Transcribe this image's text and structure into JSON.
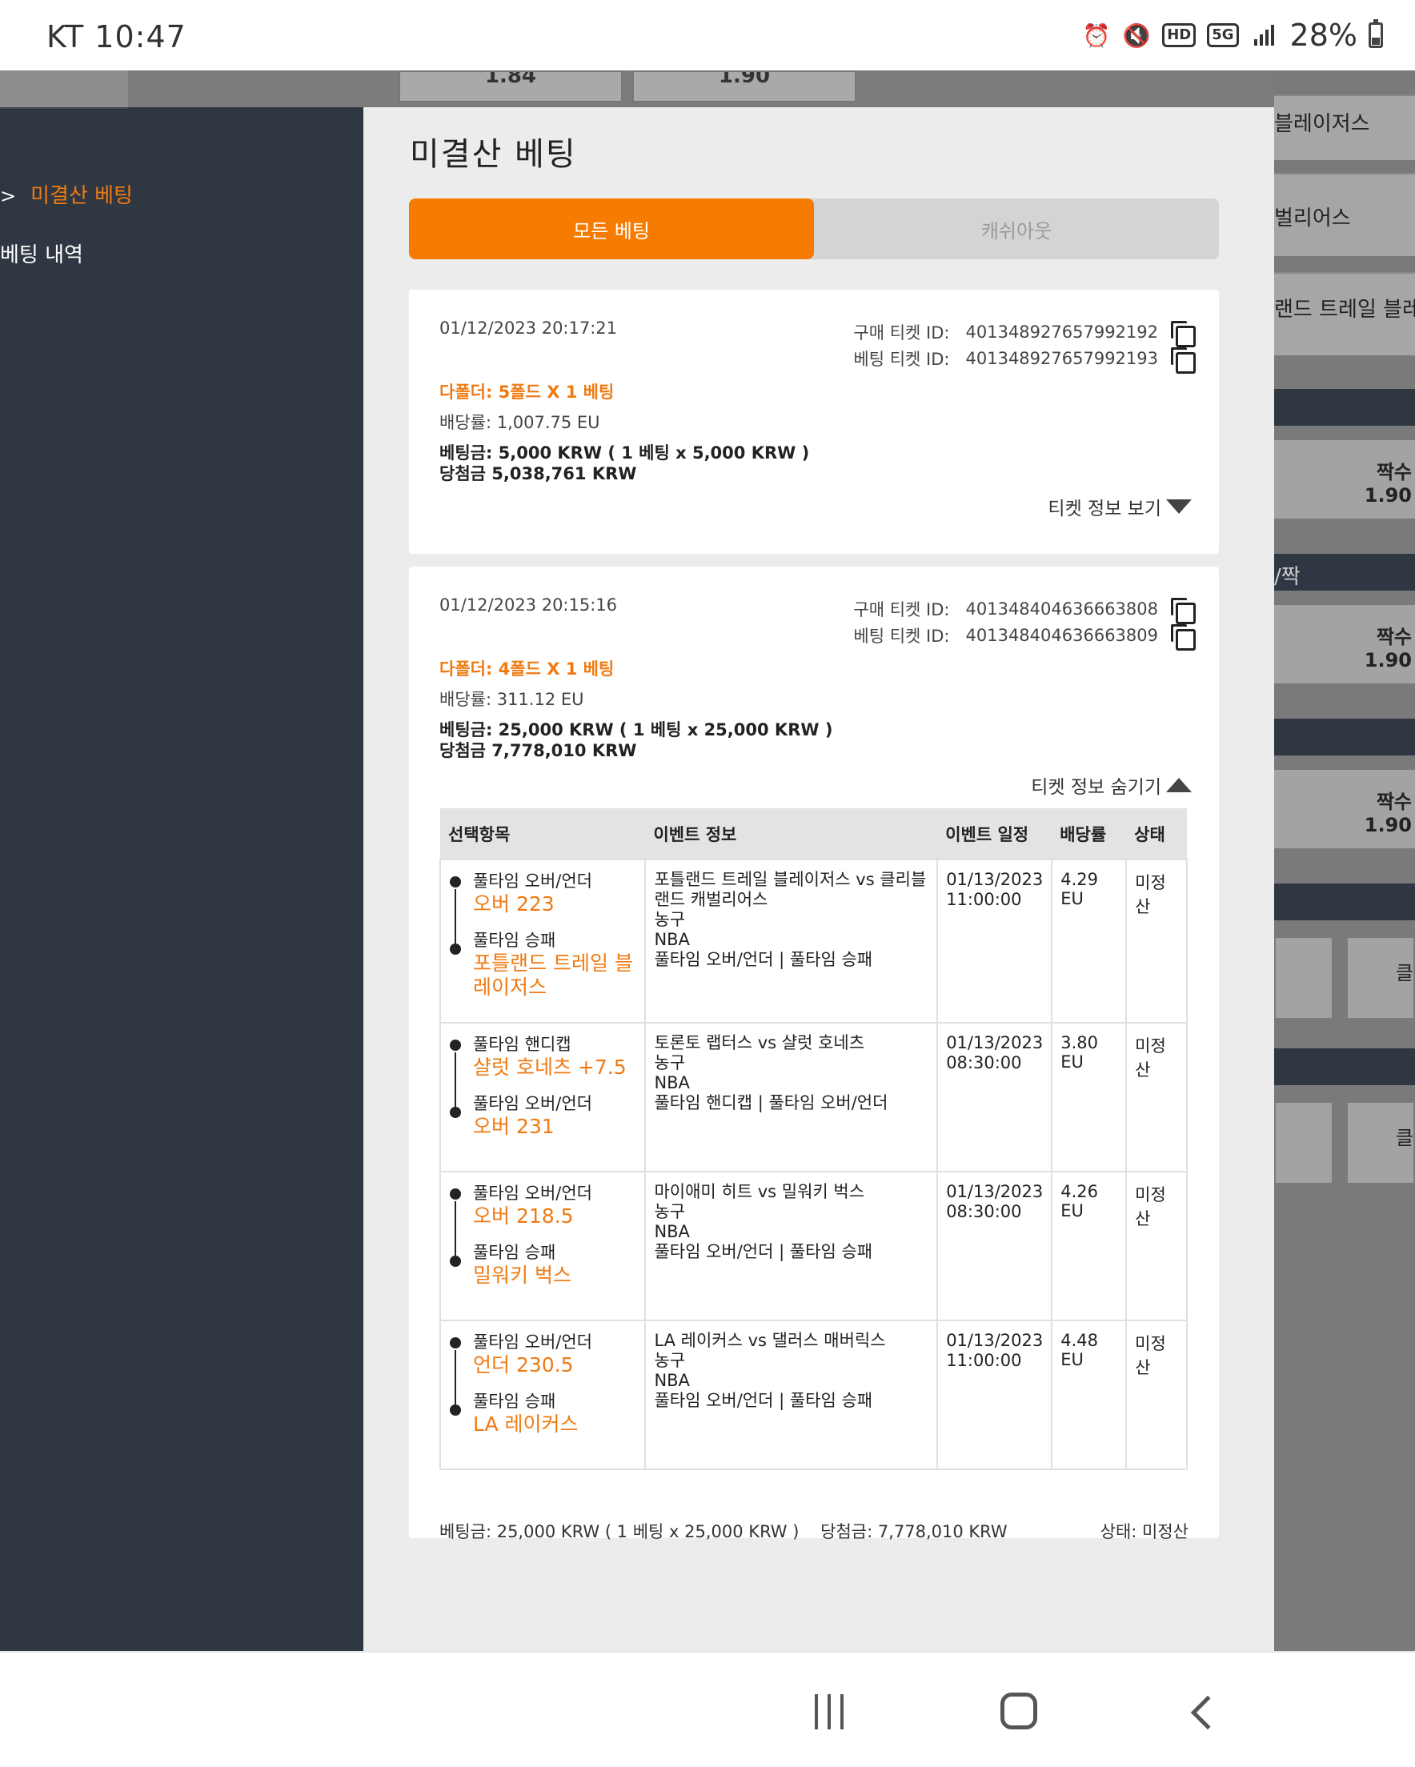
{
  "status_bar": {
    "carrier": "KT",
    "time": "10:47",
    "network_badge_hd": "HD",
    "network_badge_5g": "5G",
    "battery": "28%"
  },
  "background": {
    "top_odds": [
      "1.84",
      "1.90"
    ],
    "right_labels": [
      "블레이저스",
      "벌리어스",
      "랜드 트레일 블레이",
      "짝수",
      "1.90",
      "/짝",
      "짝수",
      "1.90",
      "짝수",
      "1.90",
      "클",
      "클"
    ]
  },
  "sidebar": {
    "items": [
      {
        "label": "미결산 베팅",
        "active": true
      },
      {
        "label": "베팅 내역",
        "active": false
      }
    ]
  },
  "panel": {
    "title": "미결산 베팅",
    "tabs": [
      {
        "label": "모든 베팅",
        "active": true
      },
      {
        "label": "캐쉬아웃",
        "active": false
      }
    ]
  },
  "tickets": [
    {
      "datetime": "01/12/2023 20:17:21",
      "purchase_id_label": "구매 티켓 ID:",
      "purchase_id": "401348927657992192",
      "bet_id_label": "베팅 티켓 ID:",
      "bet_id": "401348927657992193",
      "fold_label": "다폴더: 5폴드 X 1 베팅",
      "odds_label": "배당률: 1,007.75 EU",
      "stake_label": "베팅금: 5,000 KRW ( 1 베팅 x 5,000 KRW )",
      "win_label": "당첨금 5,038,761 KRW",
      "toggle_label": "티켓 정보 보기"
    },
    {
      "datetime": "01/12/2023 20:15:16",
      "purchase_id_label": "구매 티켓 ID:",
      "purchase_id": "401348404636663808",
      "bet_id_label": "베팅 티켓 ID:",
      "bet_id": "401348404636663809",
      "fold_label": "다폴더: 4폴드 X 1 베팅",
      "odds_label": "배당률: 311.12 EU",
      "stake_label": "베팅금: 25,000 KRW ( 1 베팅 x 25,000 KRW )",
      "win_label": "당첨금 7,778,010 KRW",
      "toggle_label": "티켓 정보 숨기기",
      "table": {
        "headers": [
          "선택항목",
          "이벤트 정보",
          "이벤트 일정",
          "배당률",
          "상태"
        ],
        "rows": [
          {
            "market1": "풀타임 오버/언더",
            "pick1": "오버 223",
            "market2": "풀타임 승패",
            "pick2": "포틀랜드 트레일 블레이저스",
            "event_lines": [
              "포틀랜드 트레일 블레이저스 vs 클리블랜드 캐벌리어스",
              "농구",
              "NBA",
              "풀타임 오버/언더 | 풀타임 승패"
            ],
            "date": "01/13/2023",
            "time": "11:00:00",
            "odds": "4.29 EU",
            "status": "미정산"
          },
          {
            "market1": "풀타임 핸디캡",
            "pick1": "샬럿 호네츠 +7.5",
            "market2": "풀타임 오버/언더",
            "pick2": "오버 231",
            "event_lines": [
              "토론토 랩터스 vs 샬럿 호네츠",
              "농구",
              "NBA",
              "풀타임 핸디캡 | 풀타임 오버/언더"
            ],
            "date": "01/13/2023",
            "time": "08:30:00",
            "odds": "3.80 EU",
            "status": "미정산"
          },
          {
            "market1": "풀타임 오버/언더",
            "pick1": "오버 218.5",
            "market2": "풀타임 승패",
            "pick2": "밀워키 벅스",
            "event_lines": [
              "마이애미 히트 vs 밀워키 벅스",
              "농구",
              "NBA",
              "풀타임 오버/언더 | 풀타임 승패"
            ],
            "date": "01/13/2023",
            "time": "08:30:00",
            "odds": "4.26 EU",
            "status": "미정산"
          },
          {
            "market1": "풀타임 오버/언더",
            "pick1": "언더 230.5",
            "market2": "풀타임 승패",
            "pick2": "LA 레이커스",
            "event_lines": [
              "LA 레이커스 vs 댈러스 매버릭스",
              "농구",
              "NBA",
              "풀타임 오버/언더 | 풀타임 승패"
            ],
            "date": "01/13/2023",
            "time": "11:00:00",
            "odds": "4.48 EU",
            "status": "미정산"
          }
        ]
      },
      "footer": {
        "stake": "베팅금: 25,000 KRW ( 1 베팅 x 25,000 KRW )",
        "win": "당첨금: 7,778,010 KRW",
        "status": "상태: 미정산"
      }
    }
  ],
  "colors": {
    "accent": "#f57c00",
    "sidebar_bg": "#2f3742",
    "panel_bg": "#ececec"
  }
}
